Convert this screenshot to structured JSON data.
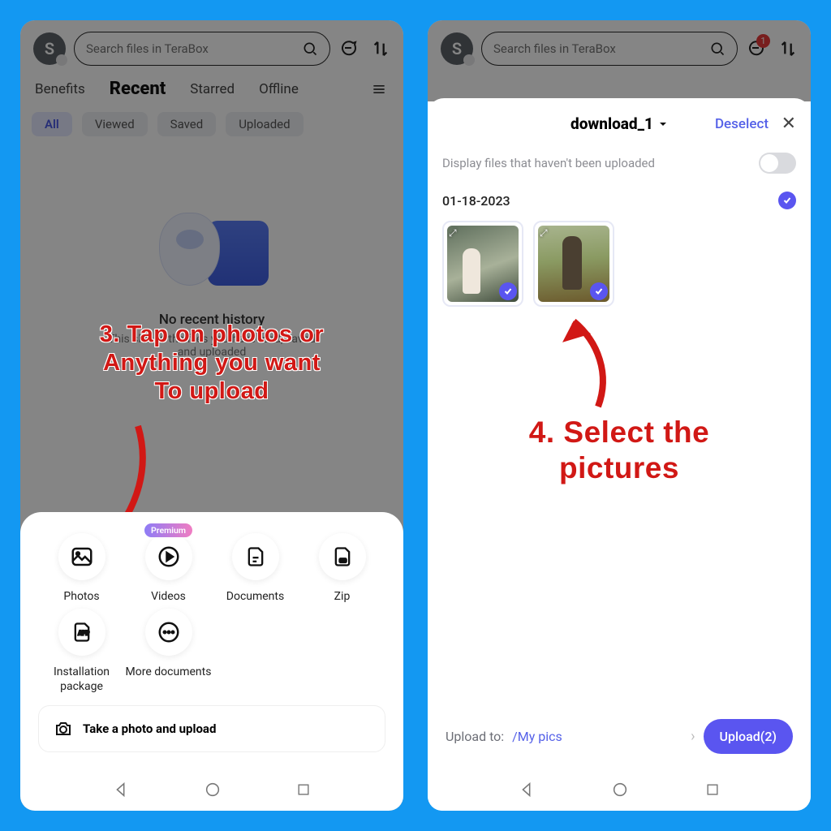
{
  "left": {
    "avatar_letter": "S",
    "search_placeholder": "Search files in TeraBox",
    "tabs": {
      "benefits": "Benefits",
      "recent": "Recent",
      "starred": "Starred",
      "offline": "Offline"
    },
    "filters": {
      "all": "All",
      "viewed": "Viewed",
      "saved": "Saved",
      "uploaded": "Uploaded"
    },
    "empty_title": "No recent history",
    "empty_sub_line1": "This shows the files you have read, saved",
    "empty_sub_line2": "and uploaded",
    "annotation": "3. Tap on photos or\nAnything you want\nTo upload",
    "sheet": {
      "photos": "Photos",
      "videos": "Videos",
      "documents": "Documents",
      "zip": "Zip",
      "installation": "Installation\npackage",
      "more": "More documents",
      "premium_badge": "Premium",
      "camera_row": "Take a photo and upload"
    }
  },
  "right": {
    "avatar_letter": "S",
    "search_placeholder": "Search files in TeraBox",
    "badge_count": "1",
    "picker_title": "download_1",
    "deselect": "Deselect",
    "toggle_label": "Display files that haven't been uploaded",
    "date": "01-18-2023",
    "annotation": "4. Select the\npictures",
    "footer": {
      "upload_to": "Upload to:",
      "path": "/My pics",
      "button": "Upload(2)"
    }
  }
}
